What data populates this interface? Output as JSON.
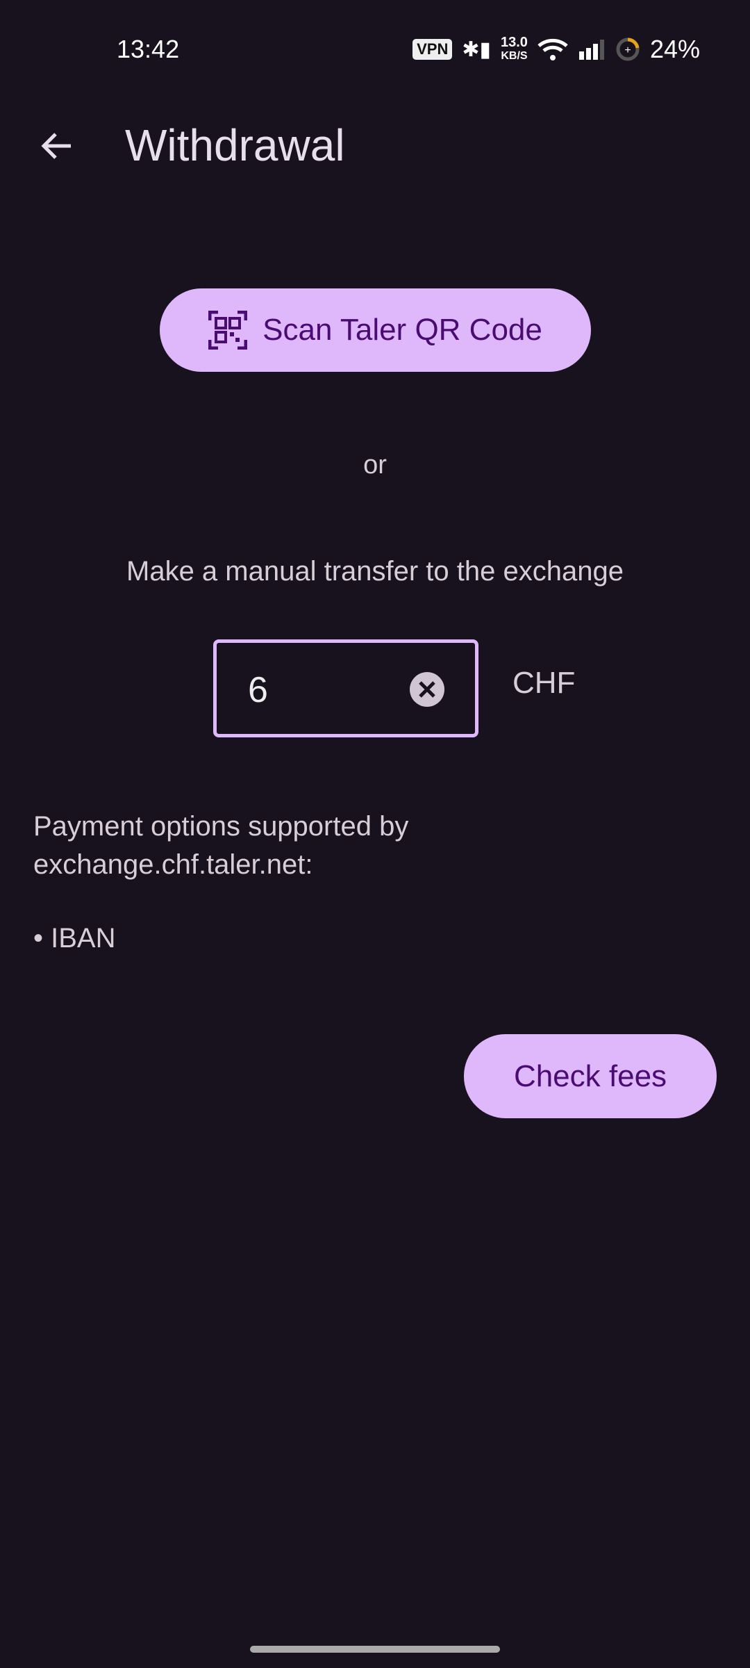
{
  "status_bar": {
    "time": "13:42",
    "vpn": "VPN",
    "speed_value": "13.0",
    "speed_unit": "KB/S",
    "battery": "24%"
  },
  "header": {
    "title": "Withdrawal"
  },
  "scan_button": {
    "label": "Scan Taler QR Code"
  },
  "or_label": "or",
  "manual_label": "Make a manual transfer to the exchange",
  "amount": {
    "value": "6",
    "currency": "CHF"
  },
  "payment": {
    "line1": "Payment options supported by",
    "line2": "exchange.chf.taler.net:",
    "items": [
      "• IBAN"
    ]
  },
  "check_fees": {
    "label": "Check fees"
  },
  "colors": {
    "accent": "#dfb8fc",
    "on_accent": "#4a0b73",
    "background": "#17121d"
  }
}
